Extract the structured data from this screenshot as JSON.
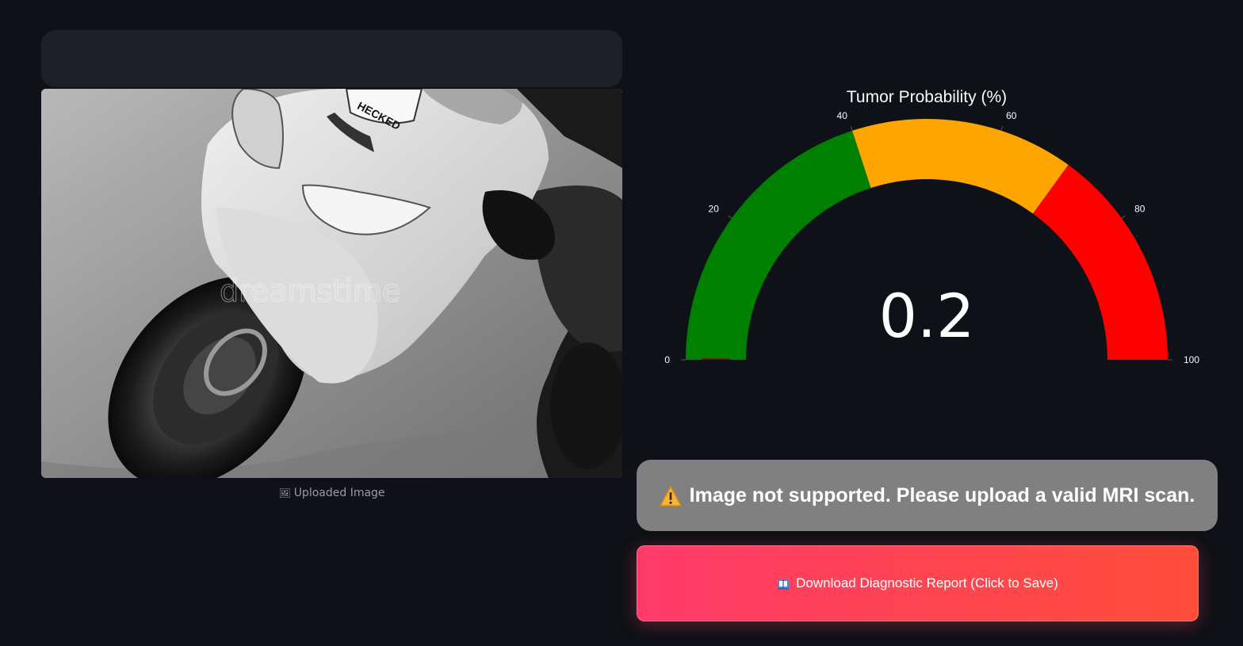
{
  "upload": {
    "caption_icon": "picture-icon",
    "caption": "Uploaded Image",
    "watermark": "dreamstime",
    "plate_text": "HECKED"
  },
  "gauge": {
    "title": "Tumor Probability (%)",
    "value": 0.2,
    "value_text": "0.2",
    "min": 0,
    "max": 100,
    "ticks": [
      "0",
      "20",
      "40",
      "60",
      "80",
      "100"
    ],
    "tick_values": [
      0,
      20,
      40,
      60,
      80,
      100
    ],
    "ranges": [
      {
        "from": 0,
        "to": 40,
        "color": "#008000"
      },
      {
        "from": 40,
        "to": 70,
        "color": "#ffa500"
      },
      {
        "from": 70,
        "to": 100,
        "color": "#ff0000"
      }
    ],
    "bar_color": "#8b0000"
  },
  "alert": {
    "icon": "warning-icon",
    "text": "Image not supported. Please upload a valid MRI scan."
  },
  "download": {
    "icon": "book-icon",
    "label": "Download Diagnostic Report (Click to Save)"
  }
}
